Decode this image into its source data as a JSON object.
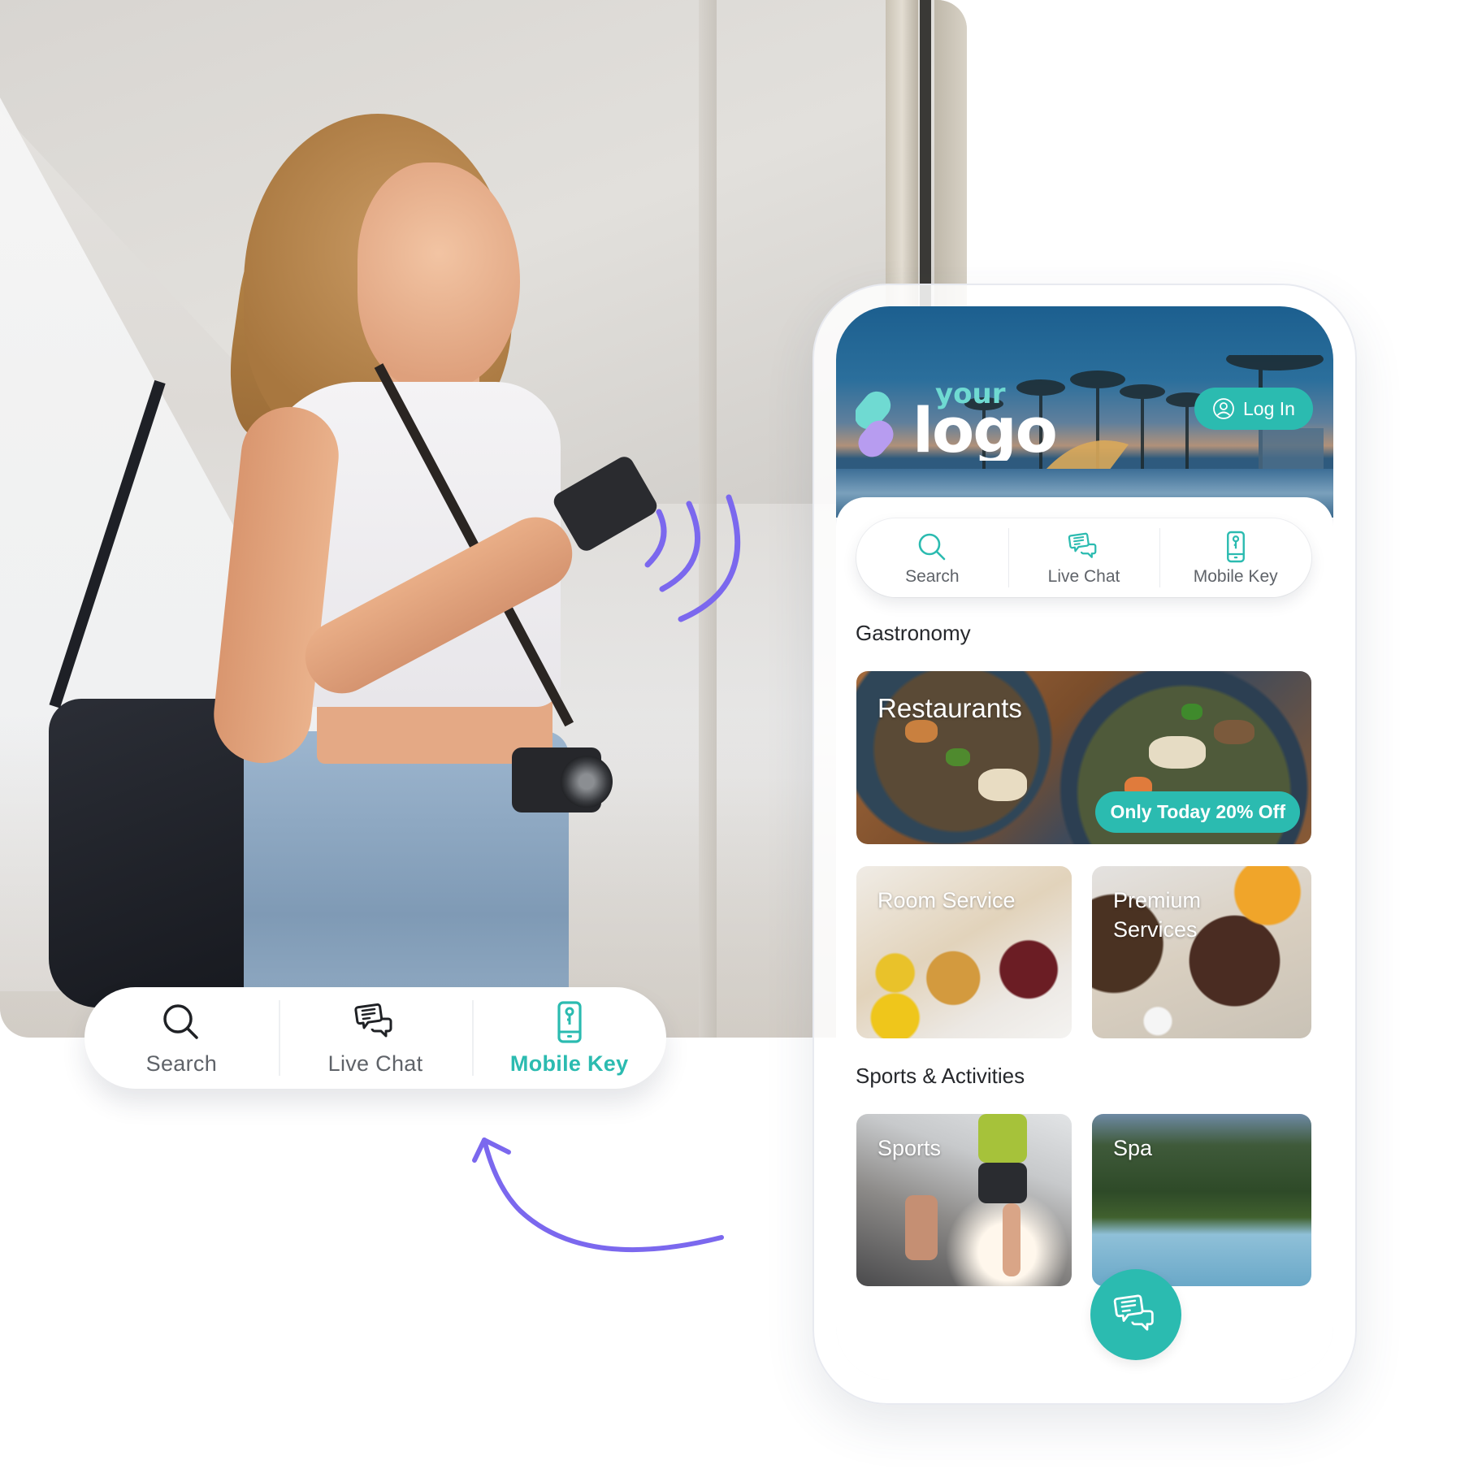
{
  "hero": {
    "image_alt": "Smiling woman holding a smartphone near a glass building"
  },
  "floating_nav": {
    "items": [
      {
        "label": "Search",
        "icon": "search-icon",
        "active": false
      },
      {
        "label": "Live Chat",
        "icon": "chat-bubbles-icon",
        "active": false
      },
      {
        "label": "Mobile Key",
        "icon": "mobile-key-icon",
        "active": true
      }
    ]
  },
  "app": {
    "logo": {
      "line1": "your",
      "line2": "logo"
    },
    "login_label": "Log In",
    "quick_actions": [
      {
        "label": "Search",
        "icon": "search-icon"
      },
      {
        "label": "Live Chat",
        "icon": "chat-bubbles-icon"
      },
      {
        "label": "Mobile Key",
        "icon": "mobile-key-icon"
      }
    ],
    "sections": [
      {
        "title": "Gastronomy",
        "cards": [
          {
            "label": "Restaurants",
            "badge": "Only Today 20% Off"
          },
          {
            "label": "Room Service"
          },
          {
            "label": "Premium\nServices"
          }
        ]
      },
      {
        "title": "Sports & Activities",
        "cards": [
          {
            "label": "Sports"
          },
          {
            "label": "Spa"
          }
        ]
      }
    ],
    "fab_icon": "chat-bubbles-icon"
  },
  "colors": {
    "accent": "#2bbbb0",
    "decoration": "#7b68ee",
    "logo_teal": "#6fdad2",
    "logo_purple": "#b79cf0",
    "text_primary": "#26282c",
    "text_secondary": "#5f6369"
  }
}
